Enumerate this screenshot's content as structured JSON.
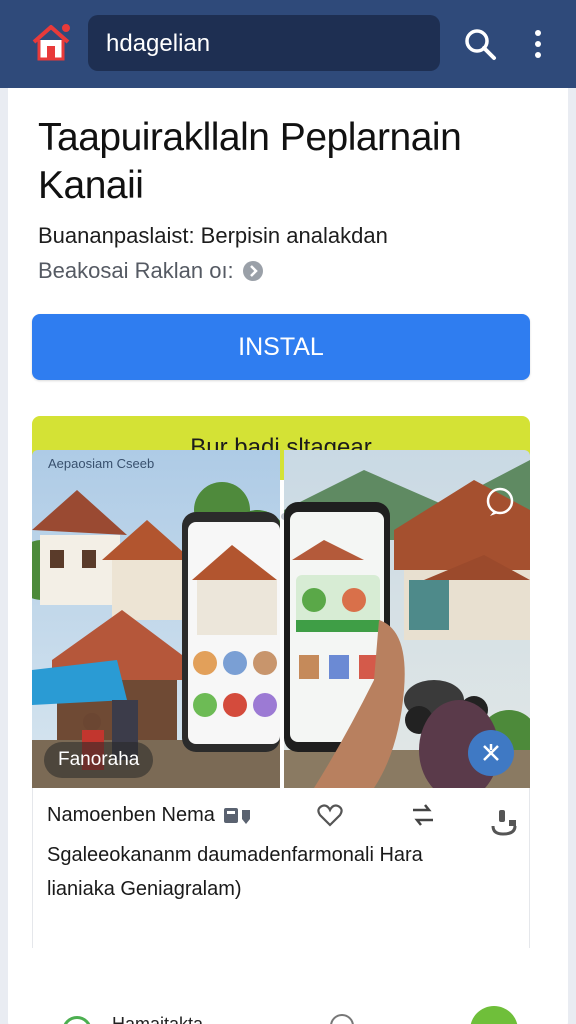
{
  "header": {
    "search_value": "hdagelian",
    "home_icon": "home-icon",
    "search_icon": "search-icon",
    "more_icon": "more-vertical-icon",
    "bar_color": "#2f4a7a",
    "notification_color": "#e83a3a"
  },
  "app": {
    "title": "Taapuirakllaln Peplarnain Kanaii",
    "subtitle": "Buananpaslaist: Berpisin analakdan",
    "developer": "Beakosai Raklan oı:",
    "info_icon": "info-icon"
  },
  "actions": {
    "install_label": "INSTAL",
    "secondary_label": "Bur badi sltagear",
    "install_color": "#2f7df0",
    "secondary_color": "#d4e235"
  },
  "gallery": {
    "top_label": "Aepaosiam Cseeb",
    "badge_label": "Fanoraha",
    "page_dots": 2
  },
  "details": {
    "app_name": "Namoenben Nema",
    "description_line1": "Sgaleeokananm daumadenfarmonali Hara",
    "description_line2": "lianiaka Geniagralam)",
    "heart_icon": "heart-icon",
    "share_icon": "share-icon",
    "side_icon": "stand-icon"
  },
  "bottom": {
    "partial_text": "Hamaitakta"
  }
}
